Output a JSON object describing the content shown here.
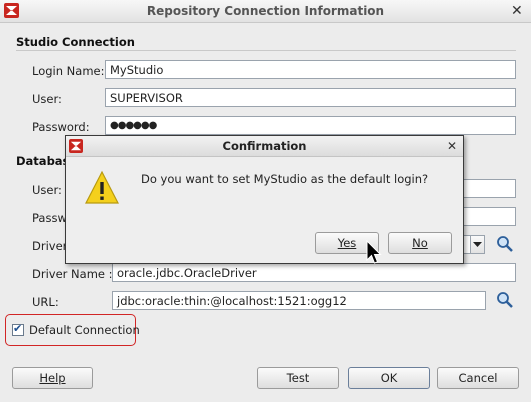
{
  "window": {
    "title": "Repository Connection Information",
    "close": "✕"
  },
  "studio": {
    "section_title": "Studio Connection",
    "login_name_label": "Login Name:",
    "login_name_value": "MyStudio",
    "user_label": "User:",
    "user_value": "SUPERVISOR",
    "password_label": "Password:",
    "password_value": "●●●●●●"
  },
  "database": {
    "section_title": "Database",
    "user_label": "User:",
    "password_label": "Passw",
    "driver_label": "Driver",
    "driver_name_label": "Driver Name :",
    "driver_name_value": "oracle.jdbc.OracleDriver",
    "url_label": "URL:",
    "url_value": "jdbc:oracle:thin:@localhost:1521:ogg12"
  },
  "default_connection": {
    "label": "Default Connection",
    "checked": true,
    "check_mark": "✔"
  },
  "buttons": {
    "help": "Help",
    "test": "Test",
    "ok": "OK",
    "cancel": "Cancel"
  },
  "confirmation": {
    "title": "Confirmation",
    "close": "✕",
    "message": "Do you want to set MyStudio as the default login?",
    "yes": "Yes",
    "no": "No"
  },
  "colors": {
    "highlight": "#d12525",
    "app_icon": "#c8261f",
    "warning": "#f4d01c"
  }
}
